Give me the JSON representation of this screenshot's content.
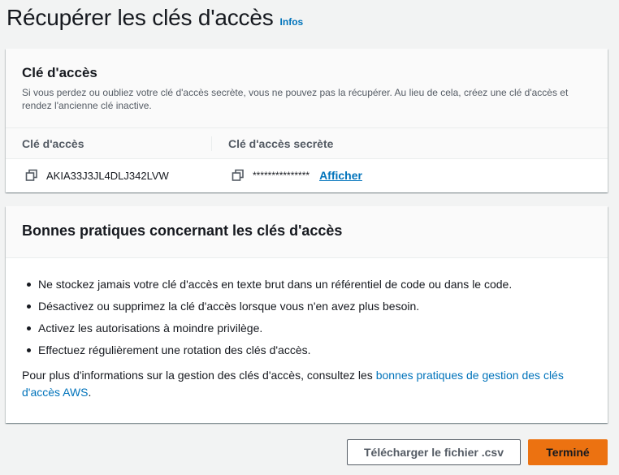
{
  "header": {
    "title": "Récupérer les clés d'accès",
    "info_label": "Infos"
  },
  "access_key_panel": {
    "title": "Clé d'accès",
    "description": "Si vous perdez ou oubliez votre clé d'accès secrète, vous ne pouvez pas la récupérer. Au lieu de cela, créez une clé d'accès et rendez l'ancienne clé inactive.",
    "col_access_key": "Clé d'accès",
    "col_secret_key": "Clé d'accès secrète",
    "access_key_value": "AKIA33J3JL4DLJ342LVW",
    "secret_key_masked": "***************",
    "show_label": "Afficher",
    "copy_icon": "copy-icon"
  },
  "best_practices_panel": {
    "title": "Bonnes pratiques concernant les clés d'accès",
    "items": [
      "Ne stockez jamais votre clé d'accès en texte brut dans un référentiel de code ou dans le code.",
      "Désactivez ou supprimez la clé d'accès lorsque vous n'en avez plus besoin.",
      "Activez les autorisations à moindre privilège.",
      "Effectuez régulièrement une rotation des clés d'accès."
    ],
    "more_info_text": "Pour plus d'informations sur la gestion des clés d'accès, consultez les ",
    "more_info_link": "bonnes pratiques de gestion des clés d'accès AWS",
    "more_info_suffix": "."
  },
  "footer": {
    "download_label": "Télécharger le fichier .csv",
    "done_label": "Terminé"
  },
  "colors": {
    "link": "#0073bb",
    "primary_button": "#ec7211",
    "background": "#f2f3f3"
  }
}
